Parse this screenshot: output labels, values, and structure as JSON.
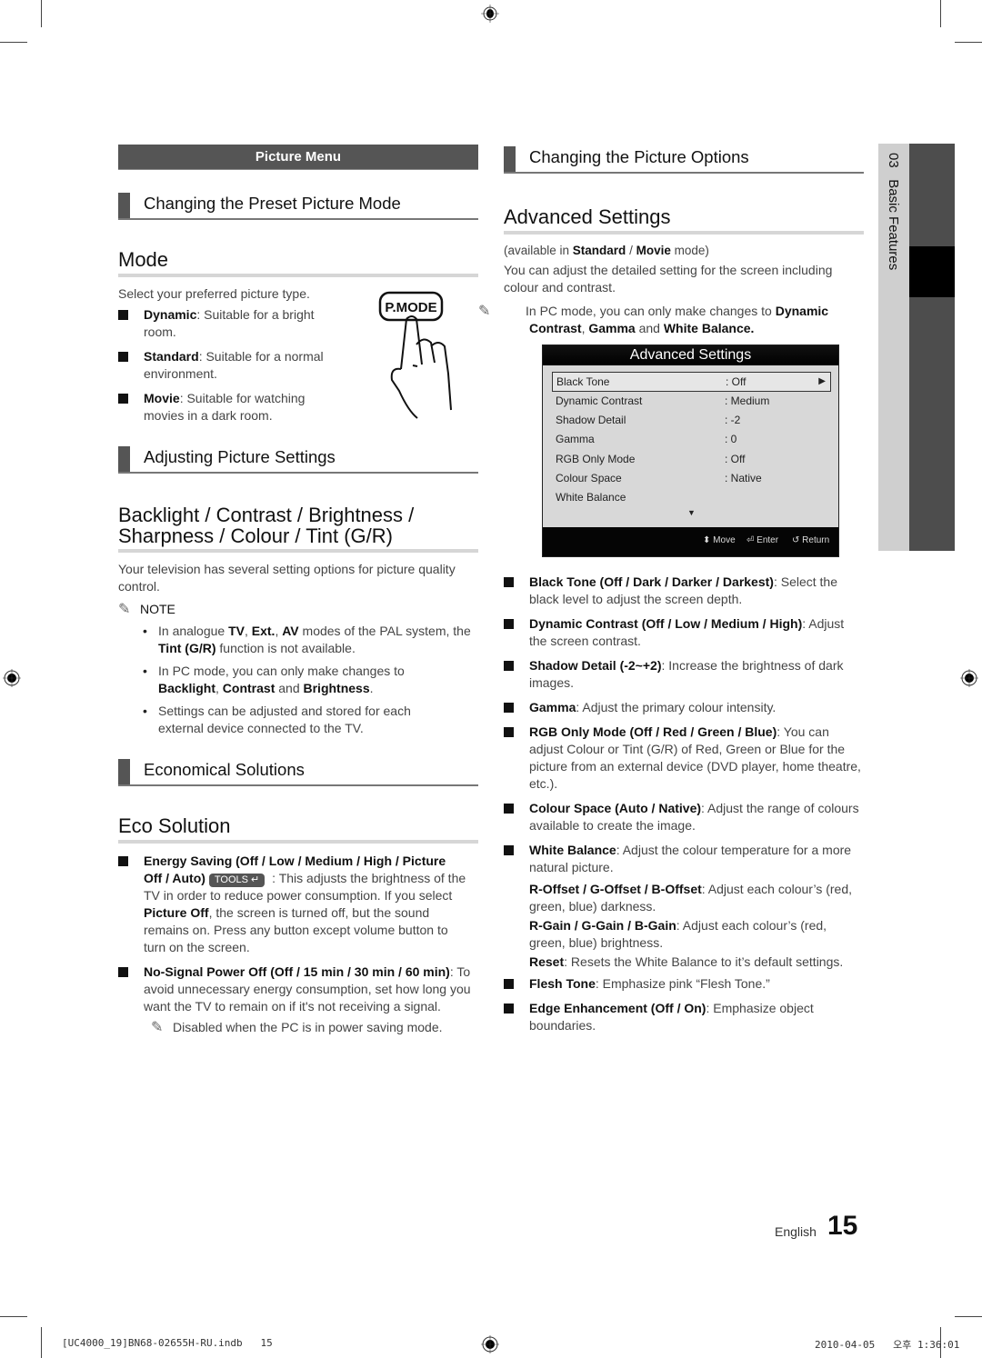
{
  "left_column": {
    "menu_bar": "Picture Menu",
    "section1_heading": "Changing the Preset Picture Mode",
    "mode": {
      "title": "Mode",
      "intro": "Select your preferred picture type.",
      "button_label": "P.MODE",
      "items": [
        {
          "term": "Dynamic",
          "text": ": Suitable for a bright room."
        },
        {
          "term": "Standard",
          "text": ": Suitable for a normal environment."
        },
        {
          "term": "Movie",
          "text": ": Suitable for watching movies in a dark room."
        }
      ]
    },
    "section2_heading": "Adjusting Picture Settings",
    "backlight": {
      "title_line1": "Backlight / Contrast / Brightness /",
      "title_line2": "Sharpness / Colour / Tint (G/R)",
      "intro": "Your television has several setting options for picture quality control.",
      "note_label": "NOTE",
      "notes": [
        {
          "parts": [
            "In analogue ",
            "TV",
            ", ",
            "Ext.",
            ", ",
            "AV",
            " modes of the PAL system, the ",
            "Tint (G/R)",
            " function is not available."
          ]
        },
        {
          "parts": [
            "In PC mode, you can only make changes to ",
            "Backlight",
            ", ",
            "Contrast",
            " and ",
            "Brightness",
            "."
          ]
        },
        {
          "parts": [
            "Settings can be adjusted and stored for each external device connected to the TV."
          ]
        }
      ]
    },
    "section3_heading": "Economical Solutions",
    "eco": {
      "title": "Eco Solution",
      "energy_term": "Energy Saving (Off / Low / Medium / High / Picture Off / Auto)",
      "tools_label": "TOOLS",
      "energy_text1": " : This adjusts the brightness of the TV in order to reduce power consumption. If you select ",
      "energy_bold": "Picture Off",
      "energy_text2": ", the screen is turned off, but the sound remains on. Press any button except volume button to turn on the screen.",
      "nosignal_term": "No-Signal Power Off (Off / 15 min / 30 min / 60 min)",
      "nosignal_text": ": To avoid unnecessary energy consumption, set how long you want the TV to remain on if it's not receiving a signal.",
      "nosignal_note": "Disabled when the PC is in power saving mode."
    }
  },
  "right_column": {
    "section_heading": "Changing the Picture Options",
    "title": "Advanced Settings",
    "availability_pre": "(available in ",
    "availability_std": "Standard",
    "availability_sep": " / ",
    "availability_movie": "Movie",
    "availability_post": " mode)",
    "intro": "You can adjust the detailed setting for the screen including colour and contrast.",
    "pc_note_pre": "In PC mode, you can only make changes to ",
    "pc_note_b1": "Dynamic Contrast",
    "pc_note_sep": ", ",
    "pc_note_b2": "Gamma",
    "pc_note_and": " and ",
    "pc_note_b3": "White Balance.",
    "osd": {
      "title": "Advanced Settings",
      "rows": [
        {
          "label": "Black Tone",
          "value": ": Off",
          "selected": true
        },
        {
          "label": "Dynamic Contrast",
          "value": ": Medium"
        },
        {
          "label": "Shadow Detail",
          "value": ": -2"
        },
        {
          "label": "Gamma",
          "value": ": 0"
        },
        {
          "label": "RGB Only Mode",
          "value": ": Off"
        },
        {
          "label": "Colour Space",
          "value": ": Native"
        },
        {
          "label": "White Balance",
          "value": ""
        }
      ],
      "footer": {
        "move": "Move",
        "enter": "Enter",
        "return": "Return"
      }
    },
    "items": [
      {
        "term": "Black Tone (Off / Dark / Darker / Darkest)",
        "text": ": Select the black level to adjust the screen depth."
      },
      {
        "term": "Dynamic Contrast (Off / Low / Medium / High)",
        "text": ": Adjust the screen contrast."
      },
      {
        "term": "Shadow Detail (-2~+2)",
        "text": ": Increase the brightness of dark images."
      },
      {
        "term": "Gamma",
        "text": ": Adjust the primary colour intensity."
      },
      {
        "term": "RGB Only Mode (Off / Red / Green / Blue)",
        "text": ": You can adjust Colour or Tint (G/R) of Red, Green or Blue for the picture from an external device (DVD player, home theatre, etc.)."
      },
      {
        "term": "Colour Space (Auto / Native)",
        "text": ": Adjust the range of colours available to create the image."
      },
      {
        "term": "White Balance",
        "text": ": Adjust the colour temperature for a more natural picture."
      }
    ],
    "wb_sub": [
      {
        "term": "R-Offset / G-Offset / B-Offset",
        "text": ": Adjust each colour’s (red, green, blue) darkness."
      },
      {
        "term": "R-Gain / G-Gain / B-Gain",
        "text": ": Adjust each colour’s (red, green, blue) brightness."
      },
      {
        "term": "Reset",
        "text": ": Resets the White Balance to it’s default settings."
      }
    ],
    "items2": [
      {
        "term": "Flesh Tone",
        "text": ": Emphasize pink “Flesh Tone.”"
      },
      {
        "term": "Edge Enhancement (Off / On)",
        "text": ": Emphasize object boundaries."
      }
    ]
  },
  "side_tab": {
    "chapter": "03",
    "label": "Basic Features"
  },
  "footer": {
    "language": "English",
    "page_number": "15",
    "slug_file": "[UC4000_19]BN68-02655H-RU.indb   15",
    "slug_date": "2010-04-05   오후 1:36:01"
  }
}
